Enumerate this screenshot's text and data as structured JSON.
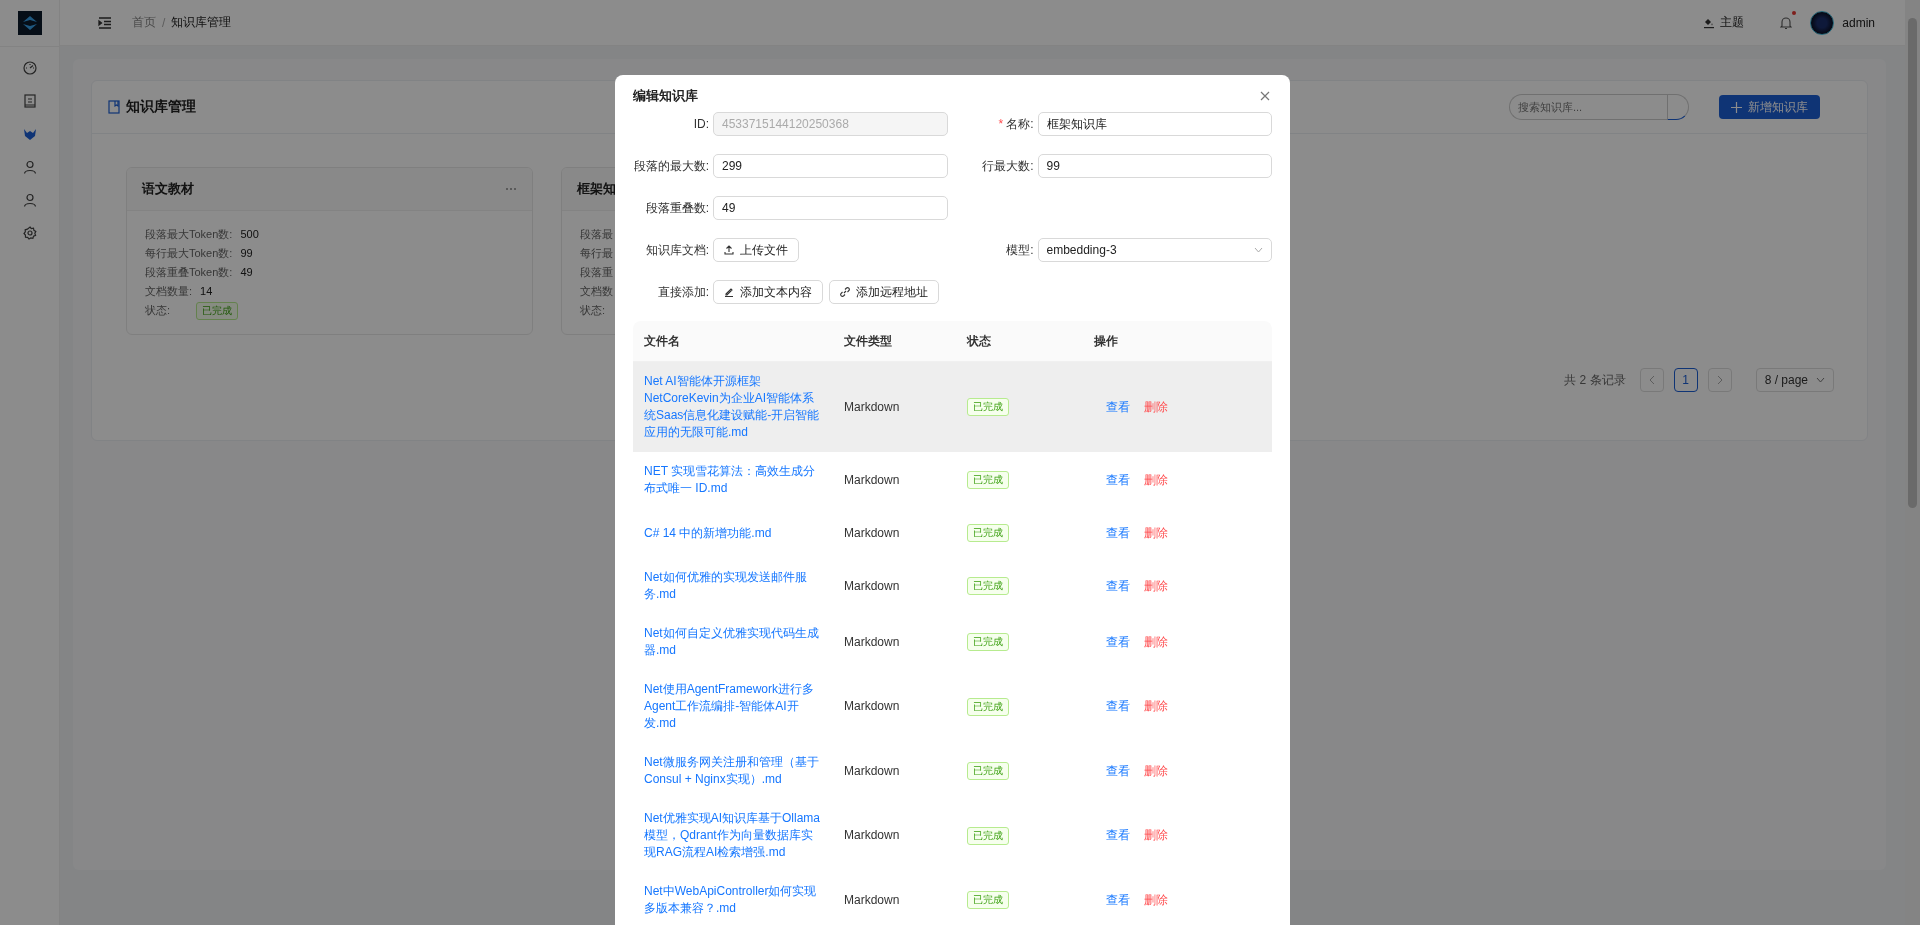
{
  "sidebar": {
    "items": [
      {
        "kind": "gauge",
        "selected": false
      },
      {
        "kind": "document",
        "selected": false
      },
      {
        "kind": "fox",
        "selected": true
      },
      {
        "kind": "user",
        "selected": false
      },
      {
        "kind": "user",
        "selected": false
      },
      {
        "kind": "settings",
        "selected": false
      }
    ]
  },
  "header": {
    "breadcrumb": {
      "items": [
        "首页",
        "知识库管理"
      ],
      "separator": "/"
    },
    "theme_button": "主题",
    "notifications": {
      "unread": true
    },
    "user": "admin"
  },
  "page": {
    "title": "知识库管理",
    "search": {
      "placeholder": "搜索知识库..."
    },
    "add_button": "新增知识库",
    "cards": [
      {
        "title": "语文教材",
        "fields": [
          {
            "label": "段落最大Token数:",
            "value": "500"
          },
          {
            "label": "每行最大Token数:",
            "value": "99"
          },
          {
            "label": "段落重叠Token数:",
            "value": "49"
          },
          {
            "label": "文档数量:",
            "value": "14"
          },
          {
            "label": "状态:",
            "tag": "已完成"
          }
        ]
      },
      {
        "title": "框架知",
        "fields": [
          {
            "label": "段落最"
          },
          {
            "label": "每行最"
          },
          {
            "label": "段落重"
          },
          {
            "label": "文档数"
          },
          {
            "label": "状态:"
          }
        ]
      }
    ],
    "pagination": {
      "total": "共 2 条记录",
      "pages": [
        {
          "label": "1",
          "selected": true
        }
      ],
      "page_size": "8 / page"
    }
  },
  "dialog": {
    "title": "编辑知识库",
    "rows": [
      [
        {
          "kind": "input",
          "label": "ID:",
          "value": "4533715144120250368",
          "disabled": true
        },
        {
          "kind": "input",
          "required_mark": "*",
          "label": "名称:",
          "value": "框架知识库",
          "disabled": false
        }
      ],
      [
        {
          "kind": "input",
          "label": "段落的最大数:",
          "value": "299",
          "disabled": false
        },
        {
          "kind": "input",
          "label": "行最大数:",
          "value": "99",
          "disabled": false
        }
      ],
      [
        {
          "kind": "input",
          "label": "段落重叠数:",
          "value": "49",
          "disabled": false
        }
      ],
      [
        {
          "kind": "buttons",
          "label": "知识库文档:",
          "buttons": [
            {
              "kind": "upload",
              "label": "上传文件"
            }
          ]
        },
        {
          "kind": "select",
          "label": "模型:",
          "value": "embedding-3"
        }
      ],
      [
        {
          "kind": "buttons",
          "label": "直接添加:",
          "buttons": [
            {
              "kind": "edit",
              "label": "添加文本内容"
            },
            {
              "kind": "link",
              "label": "添加远程地址"
            }
          ]
        }
      ]
    ],
    "table": {
      "columns": [
        "文件名",
        "文件类型",
        "状态",
        "操作"
      ],
      "rows": [
        {
          "name": "Net AI智能体开源框架NetCoreKevin为企业AI智能体系统Saas信息化建设赋能-开启智能应用的无限可能.md",
          "type": "Markdown",
          "status": "已完成",
          "highlighted": true,
          "actions": [
            {
              "kind": "view",
              "label": "查看"
            },
            {
              "kind": "delete",
              "label": "删除"
            }
          ]
        },
        {
          "name": "NET 实现雪花算法：高效生成分布式唯一 ID.md",
          "type": "Markdown",
          "status": "已完成",
          "highlighted": false,
          "actions": [
            {
              "kind": "view",
              "label": "查看"
            },
            {
              "kind": "delete",
              "label": "删除"
            }
          ]
        },
        {
          "name": "C# 14 中的新增功能.md",
          "type": "Markdown",
          "status": "已完成",
          "highlighted": false,
          "actions": [
            {
              "kind": "view",
              "label": "查看"
            },
            {
              "kind": "delete",
              "label": "删除"
            }
          ]
        },
        {
          "name": "Net如何优雅的实现发送邮件服务.md",
          "type": "Markdown",
          "status": "已完成",
          "highlighted": false,
          "actions": [
            {
              "kind": "view",
              "label": "查看"
            },
            {
              "kind": "delete",
              "label": "删除"
            }
          ]
        },
        {
          "name": "Net如何自定义优雅实现代码生成器.md",
          "type": "Markdown",
          "status": "已完成",
          "highlighted": false,
          "actions": [
            {
              "kind": "view",
              "label": "查看"
            },
            {
              "kind": "delete",
              "label": "删除"
            }
          ]
        },
        {
          "name": "Net使用AgentFramework进行多Agent工作流编排-智能体AI开发.md",
          "type": "Markdown",
          "status": "已完成",
          "highlighted": false,
          "actions": [
            {
              "kind": "view",
              "label": "查看"
            },
            {
              "kind": "delete",
              "label": "删除"
            }
          ]
        },
        {
          "name": "Net微服务网关注册和管理（基于Consul + Nginx实现）.md",
          "type": "Markdown",
          "status": "已完成",
          "highlighted": false,
          "actions": [
            {
              "kind": "view",
              "label": "查看"
            },
            {
              "kind": "delete",
              "label": "删除"
            }
          ]
        },
        {
          "name": "Net优雅实现AI知识库基于Ollama模型，Qdrant作为向量数据库实现RAG流程AI检索增强.md",
          "type": "Markdown",
          "status": "已完成",
          "highlighted": false,
          "actions": [
            {
              "kind": "view",
              "label": "查看"
            },
            {
              "kind": "delete",
              "label": "删除"
            }
          ]
        },
        {
          "name": "Net中WebApiController如何实现多版本兼容？.md",
          "type": "Markdown",
          "status": "已完成",
          "highlighted": false,
          "actions": [
            {
              "kind": "view",
              "label": "查看"
            },
            {
              "kind": "delete",
              "label": "删除"
            }
          ]
        }
      ]
    }
  }
}
